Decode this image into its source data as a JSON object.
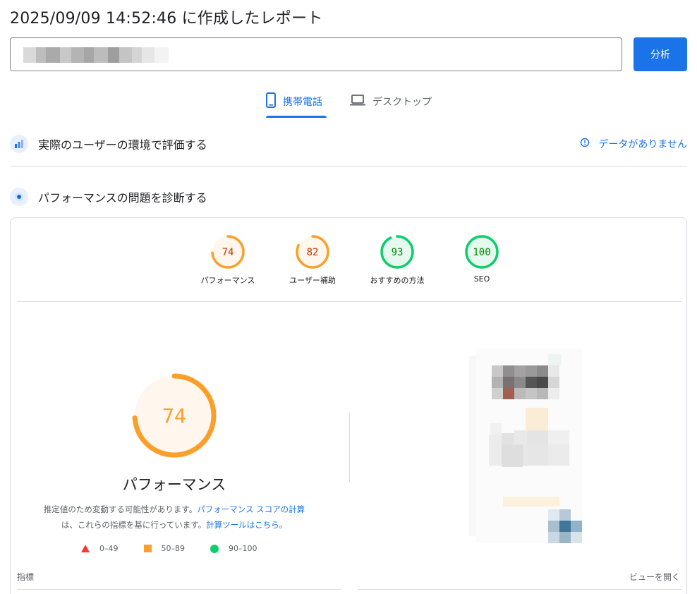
{
  "report": {
    "title": "2025/09/09 14:52:46 に作成したレポート"
  },
  "url_input": {
    "value": ""
  },
  "analyze_button": {
    "label": "分析"
  },
  "tabs": [
    {
      "label": "携帯電話",
      "icon": "smartphone-icon",
      "active": true
    },
    {
      "label": "デスクトップ",
      "icon": "laptop-icon",
      "active": false
    }
  ],
  "field_section": {
    "title": "実際のユーザーの環境で評価する",
    "icon": "crux-chart-icon",
    "status_icon": "info-icon",
    "status_text": "データがありません"
  },
  "lab_section": {
    "title": "パフォーマンスの問題を診断する",
    "icon": "lighthouse-diagnose-icon"
  },
  "category_scores": [
    {
      "label": "パフォーマンス",
      "score": "74",
      "color": "#fa9f2a"
    },
    {
      "label": "ユーザー補助",
      "score": "82",
      "color": "#fa9f2a"
    },
    {
      "label": "おすすめの方法",
      "score": "93",
      "color": "#0cce6b"
    },
    {
      "label": "SEO",
      "score": "100",
      "color": "#0cce6b"
    }
  ],
  "performance_detail": {
    "score": "74",
    "title": "パフォーマンス",
    "disclaimer_text_1": "推定値のため変動する可能性があります。",
    "disclaimer_link_1": "パフォーマンス スコアの計算",
    "disclaimer_text_2": "は、これらの指標を基に行っています。",
    "disclaimer_link_2": "計算ツールはこちら。"
  },
  "legend": [
    {
      "label": "0–49",
      "shape": "triangle",
      "color": "#ff3333"
    },
    {
      "label": "50–89",
      "shape": "square",
      "color": "#fa9f2a"
    },
    {
      "label": "90–100",
      "shape": "circle",
      "color": "#0cce6b"
    }
  ],
  "metrics": {
    "header": "指標",
    "view_toggle": "ビューを開く"
  },
  "colors": {
    "accent": "#1a73e8",
    "average": "#fa9f2a",
    "pass": "#0cce6b",
    "fail": "#ff3333"
  }
}
